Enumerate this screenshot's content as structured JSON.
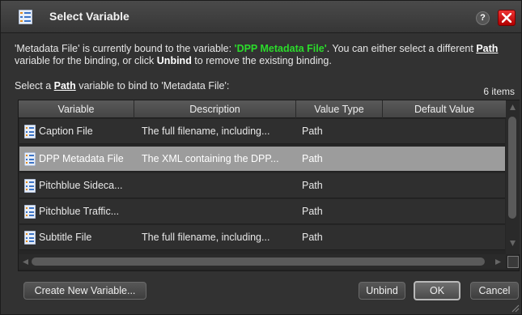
{
  "dialog": {
    "title": "Select Variable",
    "help_label": "?"
  },
  "message": {
    "part1": "'Metadata File' is currently bound to the variable: ",
    "bound_variable": "'DPP Metadata File'",
    "part2": ". You can either select a different ",
    "path_word": "Path",
    "part3": " variable for the binding, or click ",
    "unbind_word": "Unbind",
    "part4": " to remove the existing binding."
  },
  "list": {
    "label_prefix": "Select a ",
    "label_path": "Path",
    "label_suffix": " variable to bind to 'Metadata File':",
    "item_count": "6 items",
    "columns": [
      "Variable",
      "Description",
      "Value Type",
      "Default Value"
    ],
    "rows": [
      {
        "variable": "Caption File",
        "description": "The full filename, including...",
        "value_type": "Path",
        "default_value": ""
      },
      {
        "variable": "DPP Metadata File",
        "description": "The XML containing the DPP...",
        "value_type": "Path",
        "default_value": ""
      },
      {
        "variable": "Pitchblue Sideca...",
        "description": "",
        "value_type": "Path",
        "default_value": ""
      },
      {
        "variable": "Pitchblue Traffic...",
        "description": "",
        "value_type": "Path",
        "default_value": ""
      },
      {
        "variable": "Subtitle File",
        "description": "The full filename, including...",
        "value_type": "Path",
        "default_value": ""
      }
    ],
    "selected_index": 1
  },
  "buttons": {
    "create_new": "Create New Variable...",
    "unbind": "Unbind",
    "ok": "OK",
    "cancel": "Cancel"
  },
  "colors": {
    "highlight_green": "#2bdc2b",
    "close_red": "#d81c1c",
    "selected_row": "#9c9c9c"
  }
}
